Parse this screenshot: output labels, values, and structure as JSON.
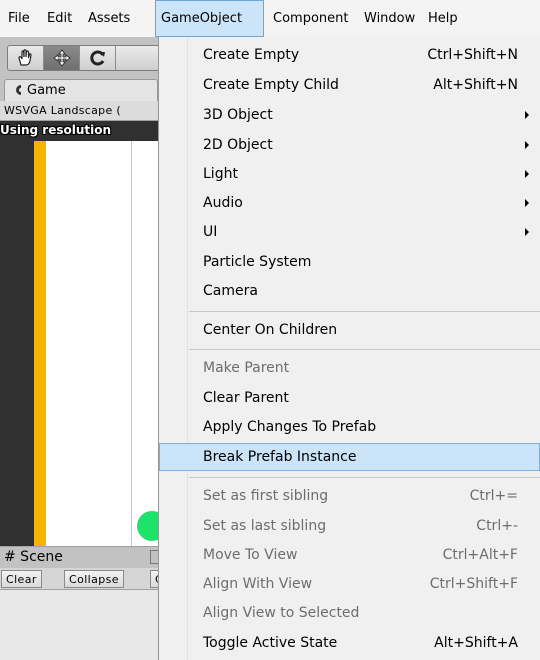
{
  "menubar": {
    "items": [
      "File",
      "Edit",
      "Assets",
      "GameObject",
      "Component",
      "Window",
      "Help"
    ],
    "active": "GameObject"
  },
  "editor": {
    "game_tab_label": "Game",
    "resolution_label": "WSVGA Landscape (",
    "using_resolution_text": "Using resolution",
    "scene_tab_label": "# Scene",
    "console_buttons": [
      "Clear",
      "Collapse",
      "C"
    ],
    "tool_icons": [
      "hand-icon",
      "move-icon",
      "rotate-icon"
    ]
  },
  "menu": {
    "groups": [
      [
        {
          "label": "Create Empty",
          "shortcut": "Ctrl+Shift+N",
          "submenu": false,
          "enabled": true
        },
        {
          "label": "Create Empty Child",
          "shortcut": "Alt+Shift+N",
          "submenu": false,
          "enabled": true
        },
        {
          "label": "3D Object",
          "shortcut": "",
          "submenu": true,
          "enabled": true
        },
        {
          "label": "2D Object",
          "shortcut": "",
          "submenu": true,
          "enabled": true
        },
        {
          "label": "Light",
          "shortcut": "",
          "submenu": true,
          "enabled": true
        },
        {
          "label": "Audio",
          "shortcut": "",
          "submenu": true,
          "enabled": true
        },
        {
          "label": "UI",
          "shortcut": "",
          "submenu": true,
          "enabled": true
        },
        {
          "label": "Particle System",
          "shortcut": "",
          "submenu": false,
          "enabled": true
        },
        {
          "label": "Camera",
          "shortcut": "",
          "submenu": false,
          "enabled": true
        }
      ],
      [
        {
          "label": "Center On Children",
          "shortcut": "",
          "submenu": false,
          "enabled": true
        }
      ],
      [
        {
          "label": "Make Parent",
          "shortcut": "",
          "submenu": false,
          "enabled": false
        },
        {
          "label": "Clear Parent",
          "shortcut": "",
          "submenu": false,
          "enabled": true
        },
        {
          "label": "Apply Changes To Prefab",
          "shortcut": "",
          "submenu": false,
          "enabled": true
        },
        {
          "label": "Break Prefab Instance",
          "shortcut": "",
          "submenu": false,
          "enabled": true,
          "highlighted": true
        }
      ],
      [
        {
          "label": "Set as first sibling",
          "shortcut": "Ctrl+=",
          "submenu": false,
          "enabled": false
        },
        {
          "label": "Set as last sibling",
          "shortcut": "Ctrl+-",
          "submenu": false,
          "enabled": false
        },
        {
          "label": "Move To View",
          "shortcut": "Ctrl+Alt+F",
          "submenu": false,
          "enabled": false
        },
        {
          "label": "Align With View",
          "shortcut": "Ctrl+Shift+F",
          "submenu": false,
          "enabled": false
        },
        {
          "label": "Align View to Selected",
          "shortcut": "",
          "submenu": false,
          "enabled": false
        },
        {
          "label": "Toggle Active State",
          "shortcut": "Alt+Shift+A",
          "submenu": false,
          "enabled": true
        }
      ]
    ]
  },
  "colors": {
    "highlight": "#cce4f7",
    "highlight_border": "#7ab0e0",
    "disabled_text": "#6d6d6d",
    "viewport_orange": "#f5b400",
    "sprite_green": "#1ee36a"
  }
}
